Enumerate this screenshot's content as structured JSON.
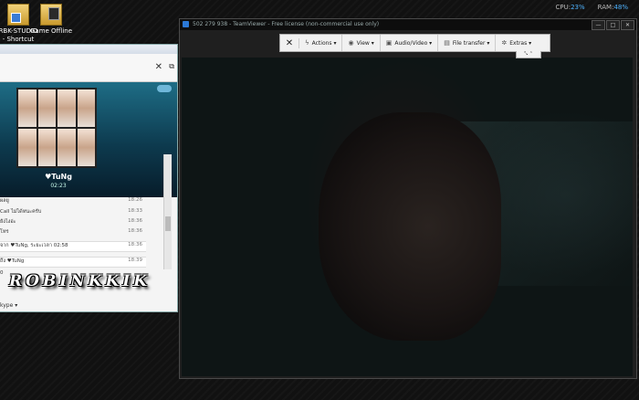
{
  "desktop": {
    "icons": [
      {
        "label_line1": "RBK-STUDIO",
        "label_line2": "- Shortcut"
      },
      {
        "label_line1": "Game Offline",
        "label_line2": ""
      }
    ]
  },
  "system_meter": {
    "cpu_label": "CPU:",
    "cpu_value": "23%",
    "ram_label": "RAM:",
    "ram_value": "48%"
  },
  "skype": {
    "contact_name": "♥TuNg",
    "call_duration": "02:23",
    "messages": [
      {
        "text": "ผลยู",
        "time": "18:26"
      },
      {
        "text": "Call ไม่ได้หนะครับ",
        "time": "18:33"
      },
      {
        "text": "ยังไงอ่ะ",
        "time": "18:36"
      },
      {
        "text": "โทร",
        "time": "18:36"
      },
      {
        "text": "จาก ♥TuNg, ระยะเวลา 02:58",
        "time": "18:36"
      },
      {
        "text": "ถึง ♥TuNg",
        "time": "18:39"
      },
      {
        "text": "0",
        "time": ""
      }
    ],
    "bottom_label": "kype ▾",
    "watermark": "ROBINKKIK"
  },
  "teamviewer": {
    "title": "502 279 938 - TeamViewer - Free license (non-commercial use only)",
    "toolbar": [
      {
        "label": "Actions ▾",
        "icon": "lightning-icon"
      },
      {
        "label": "View ▾",
        "icon": "eye-icon"
      },
      {
        "label": "Audio/Video ▾",
        "icon": "audio-video-icon"
      },
      {
        "label": "File transfer ▾",
        "icon": "file-transfer-icon"
      },
      {
        "label": "Extras ▾",
        "icon": "extras-icon"
      }
    ]
  }
}
